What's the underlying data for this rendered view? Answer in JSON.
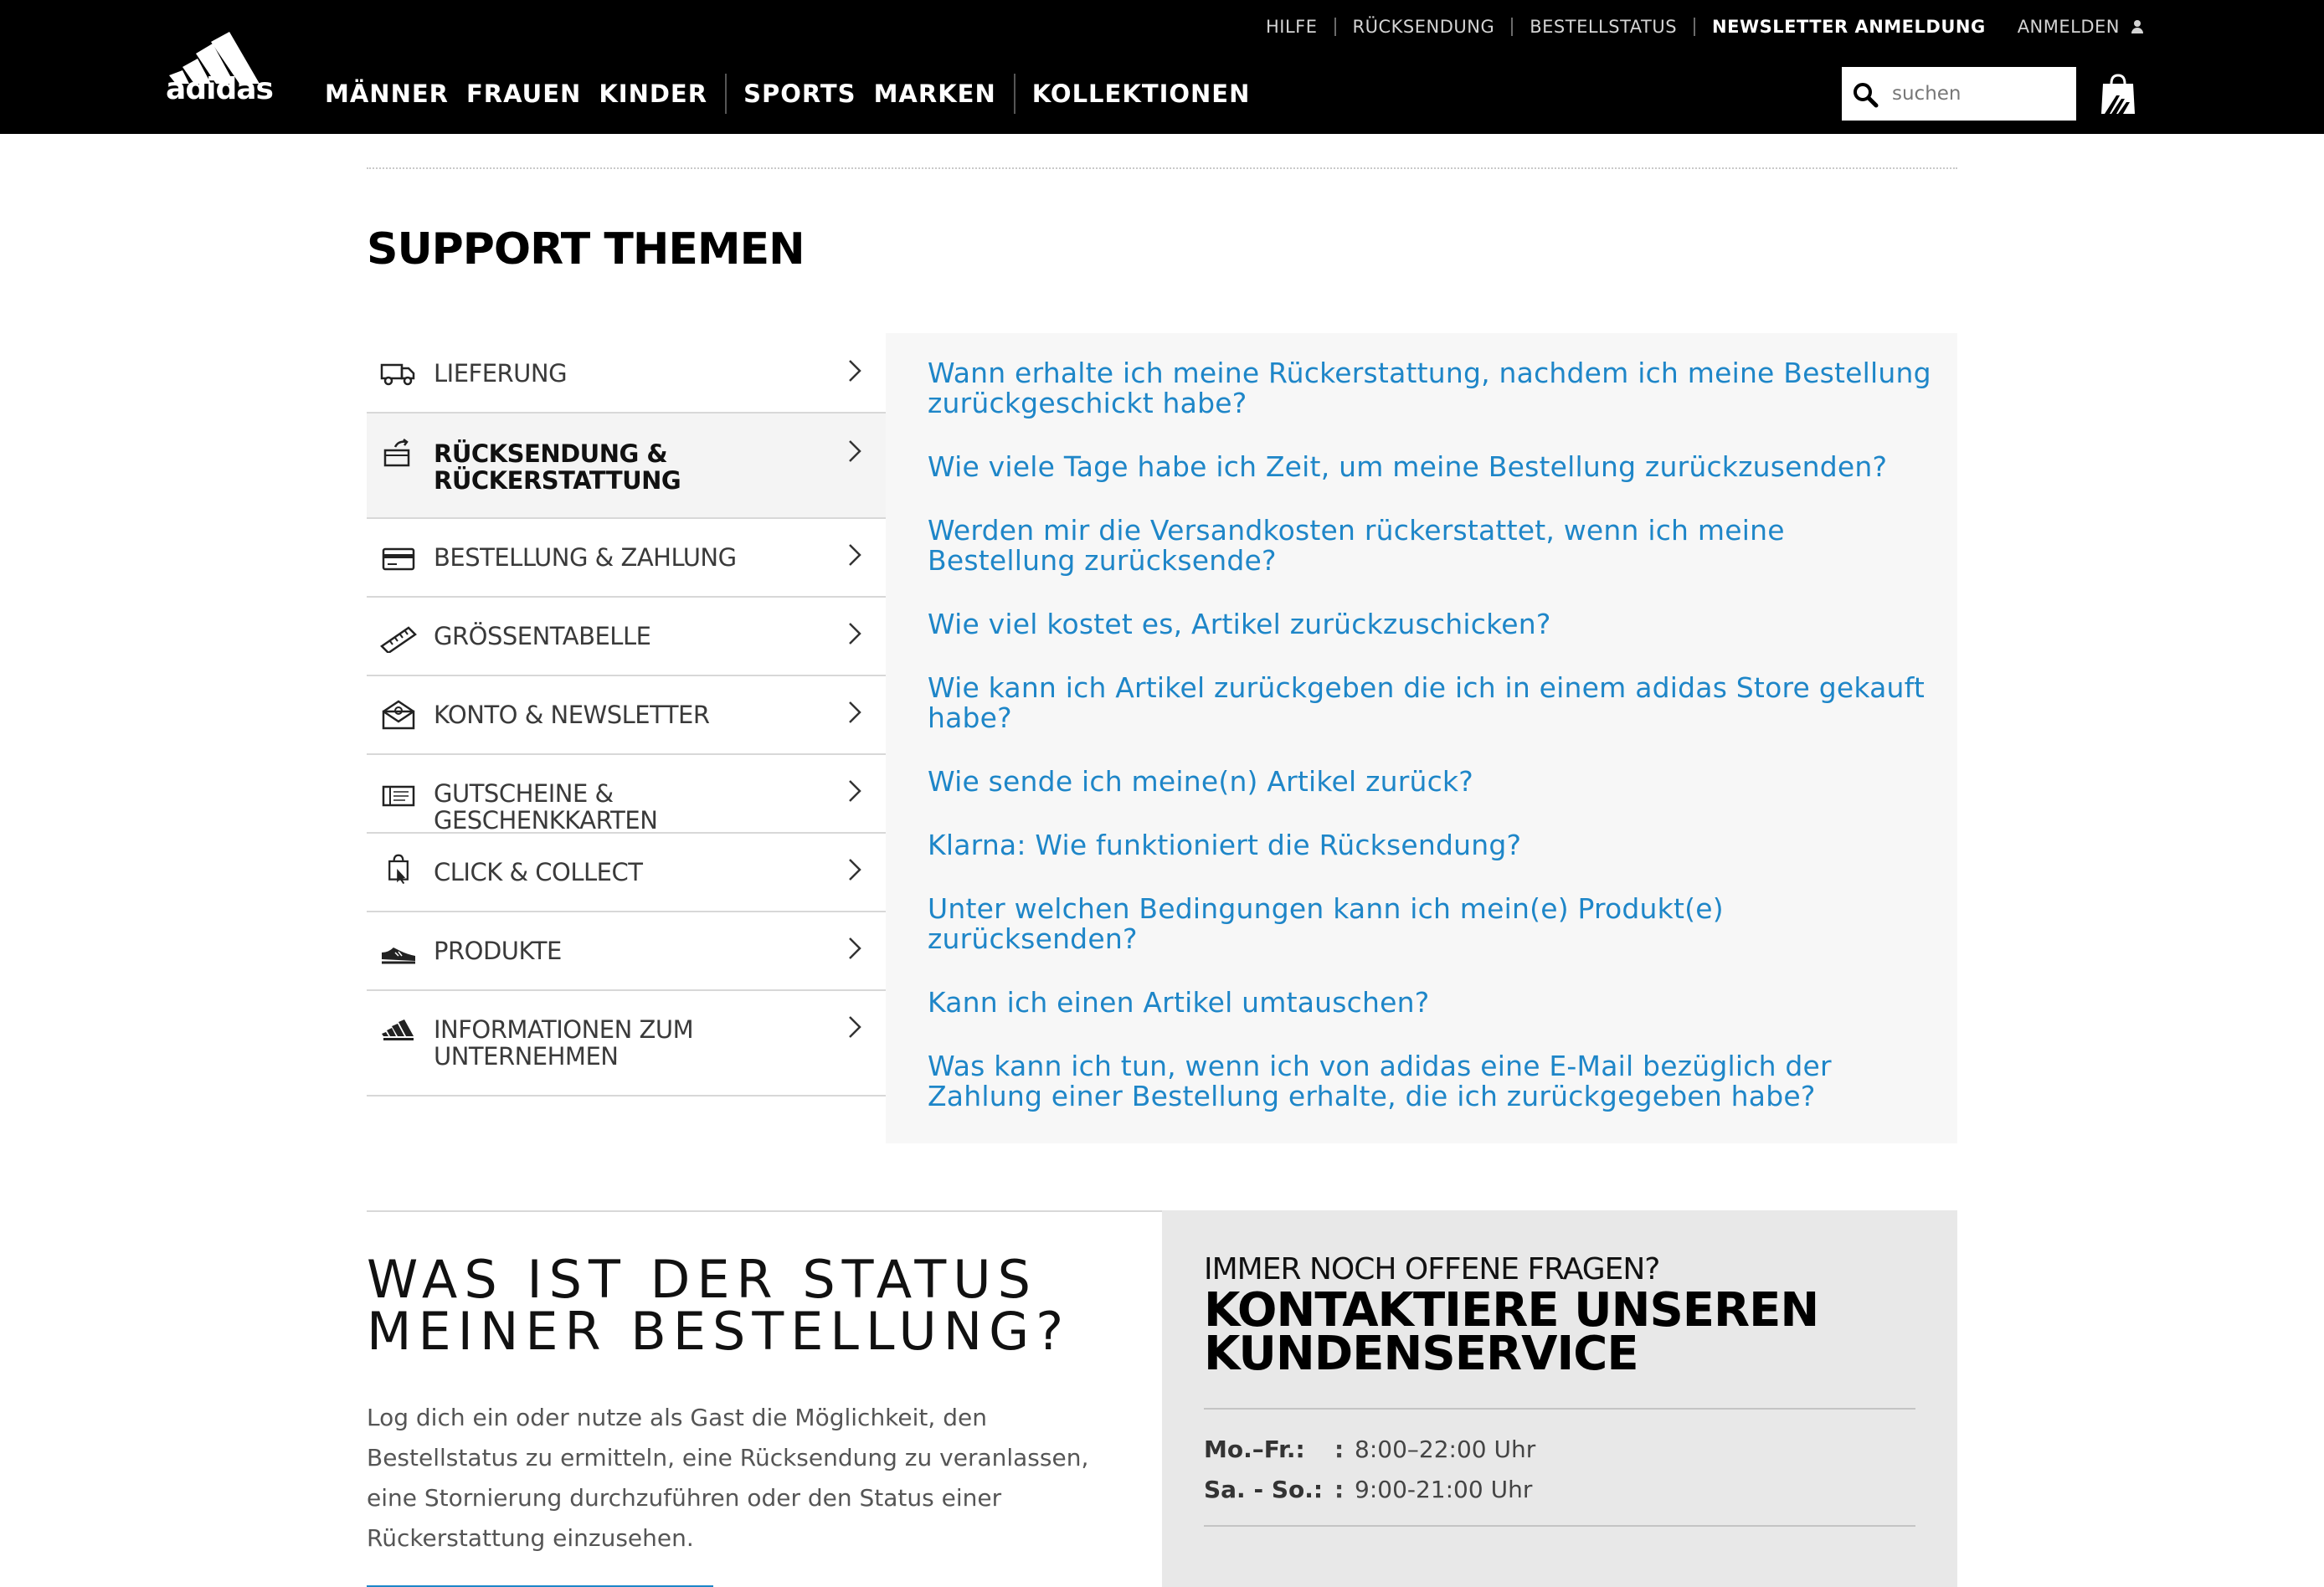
{
  "header": {
    "utility_links": [
      "HILFE",
      "RÜCKSENDUNG",
      "BESTELLSTATUS",
      "NEWSLETTER ANMELDUNG"
    ],
    "login": "ANMELDEN",
    "logo_text": "adidas",
    "nav": [
      "MÄNNER",
      "FRAUEN",
      "KINDER",
      "SPORTS",
      "MARKEN",
      "KOLLEKTIONEN"
    ],
    "search_placeholder": "suchen",
    "icons": {
      "search": "search-icon",
      "bag": "shopping-bag-icon",
      "user": "user-icon"
    }
  },
  "support": {
    "title": "SUPPORT THEMEN",
    "topics": [
      {
        "label": "LIEFERUNG",
        "icon": "delivery-truck-icon",
        "active": false
      },
      {
        "label": "RÜCKSENDUNG & RÜCKERSTATTUNG",
        "icon": "return-package-icon",
        "active": true
      },
      {
        "label": "BESTELLUNG & ZAHLUNG",
        "icon": "credit-card-icon",
        "active": false
      },
      {
        "label": "GRÖSSENTABELLE",
        "icon": "ruler-icon",
        "active": false
      },
      {
        "label": "KONTO & NEWSLETTER",
        "icon": "envelope-icon",
        "active": false
      },
      {
        "label": "GUTSCHEINE & GESCHENKKARTEN",
        "icon": "gift-card-icon",
        "active": false
      },
      {
        "label": "CLICK & COLLECT",
        "icon": "click-collect-bag-icon",
        "active": false
      },
      {
        "label": "PRODUKTE",
        "icon": "shoe-icon",
        "active": false
      },
      {
        "label": "INFORMATIONEN ZUM UNTERNEHMEN",
        "icon": "adidas-logo-icon",
        "active": false
      }
    ],
    "questions": [
      "Wann erhalte ich meine Rückerstattung, nachdem ich meine Bestellung zurückgeschickt habe?",
      "Wie viele Tage habe ich Zeit, um meine Bestellung zurückzusenden?",
      "Werden mir die Versandkosten rückerstattet, wenn ich meine Bestellung zurücksende?",
      "Wie viel kostet es, Artikel zurückzuschicken?",
      "Wie kann ich Artikel zurückgeben die ich in einem adidas Store gekauft habe?",
      "Wie sende ich meine(n) Artikel zurück?",
      "Klarna: Wie funktioniert die Rücksendung?",
      "Unter welchen Bedingungen kann ich mein(e) Produkt(e) zurücksenden?",
      "Kann ich einen Artikel umtauschen?",
      "Was kann ich tun, wenn ich von adidas eine E-Mail bezüglich der Zahlung einer Bestellung erhalte, die ich zurückgegeben habe?"
    ]
  },
  "order_status": {
    "heading_line1": "WAS IST DER STATUS",
    "heading_line2": "MEINER BESTELLUNG?",
    "text": "Log dich ein oder nutze als Gast die Möglichkeit, den Bestellstatus zu ermitteln, eine Rücksendung zu veranlassen, eine Stornierung durchzuführen oder den Status einer Rückerstattung einzusehen."
  },
  "contact": {
    "subtitle": "IMMER NOCH OFFENE FRAGEN?",
    "title": "KONTAKTIERE UNSEREN KUNDENSERVICE",
    "hours": [
      {
        "days": "Mo.–Fr.:",
        "time": "8:00–22:00 Uhr"
      },
      {
        "days": "Sa. - So.:",
        "time": "9:00-21:00 Uhr"
      }
    ]
  },
  "colors": {
    "link": "#1e86c8",
    "header_bg": "#000000",
    "panel_bg": "#f7f7f7",
    "contact_bg": "#e8e8e8"
  }
}
